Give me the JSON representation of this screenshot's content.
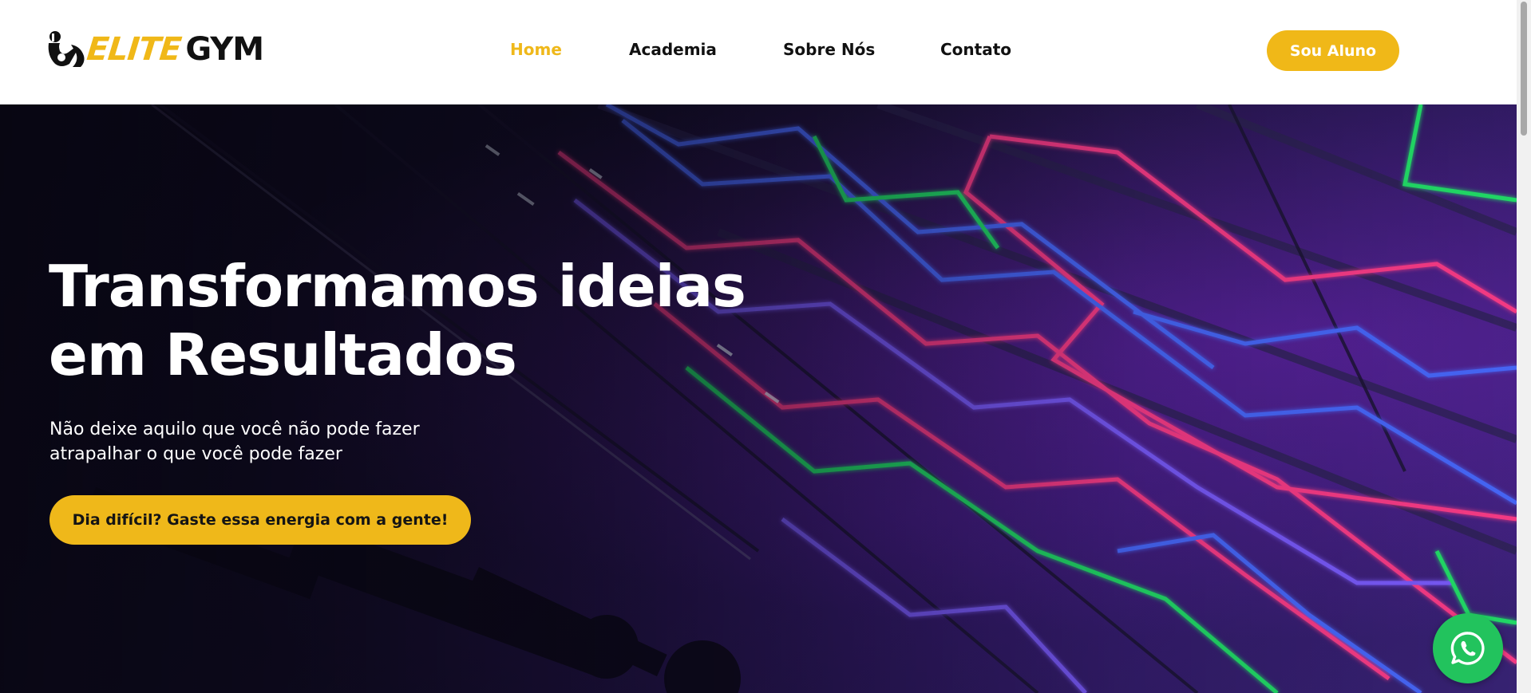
{
  "header": {
    "logo": {
      "part1": "ELITE",
      "part2": "GYM",
      "icon": "strongman-icon"
    },
    "nav": [
      {
        "label": "Home",
        "active": true
      },
      {
        "label": "Academia",
        "active": false
      },
      {
        "label": "Sobre Nós",
        "active": false
      },
      {
        "label": "Contato",
        "active": false
      }
    ],
    "cta_label": "Sou Aluno"
  },
  "hero": {
    "title_line1": "Transformamos ideias",
    "title_line2": "em Resultados",
    "subtitle_line1": "Não deixe aquilo que você não pode fazer",
    "subtitle_line2": "atrapalhar o que você pode fazer",
    "cta_label": "Dia difícil? Gaste essa energia com a gente!",
    "background": "neon-gym-photo"
  },
  "floating": {
    "icon": "whatsapp-icon"
  },
  "colors": {
    "accent": "#efb81a",
    "whatsapp": "#22c35d",
    "text_dark": "#111111",
    "text_light": "#ffffff"
  }
}
